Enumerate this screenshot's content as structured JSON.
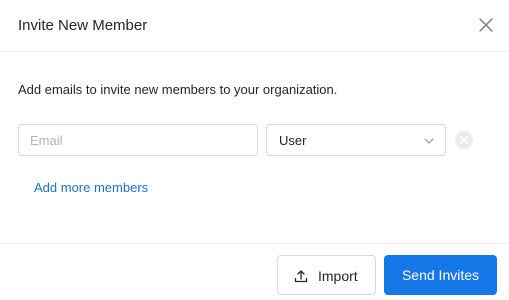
{
  "dialog": {
    "title": "Invite New Member",
    "description": "Add emails to invite new members to your organization."
  },
  "form": {
    "email_placeholder": "Email",
    "email_value": "",
    "role_selected": "User",
    "add_more_label": "Add more members"
  },
  "footer": {
    "import_label": "Import",
    "send_label": "Send Invites"
  },
  "icons": {
    "close": "close-icon",
    "chevron": "chevron-down-icon",
    "remove": "remove-row-icon",
    "import": "upload-icon"
  },
  "colors": {
    "primary": "#1677e8",
    "link": "#1f6fd6",
    "border": "#d9d9d9"
  }
}
